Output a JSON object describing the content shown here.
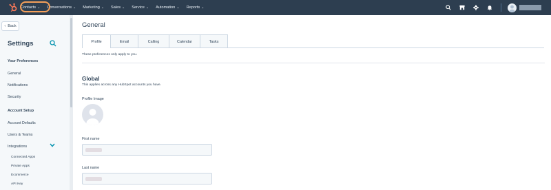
{
  "colors": {
    "topnav": "#2d3e50",
    "highlight": "#f5a05a",
    "sidebar": "#f5f8fa",
    "text": "#33475b",
    "accent": "#0091ae"
  },
  "topnav": {
    "logo_icon": "hubspot-sprocket-icon",
    "items": [
      {
        "label": "Contacts"
      },
      {
        "label": "Conversations"
      },
      {
        "label": "Marketing"
      },
      {
        "label": "Sales"
      },
      {
        "label": "Service"
      },
      {
        "label": "Automation"
      },
      {
        "label": "Reports"
      }
    ],
    "icons": [
      "search-icon",
      "marketplace-icon",
      "settings-gear-icon",
      "notifications-bell-icon"
    ]
  },
  "sidebar": {
    "back_label": "Back",
    "title": "Settings",
    "your_preferences": {
      "heading": "Your Preferences",
      "items": [
        "General",
        "Notifications",
        "Security"
      ]
    },
    "account_setup": {
      "heading": "Account Setup",
      "items": [
        "Account Defaults",
        "Users & Teams",
        "Integrations"
      ],
      "integrations_sub": [
        "Connected Apps",
        "Private Apps",
        "Ecommerce",
        "API Key"
      ]
    }
  },
  "main": {
    "title": "General",
    "tabs": [
      {
        "label": "Profile",
        "active": true
      },
      {
        "label": "Email",
        "active": false
      },
      {
        "label": "Calling",
        "active": false
      },
      {
        "label": "Calendar",
        "active": false
      },
      {
        "label": "Tasks",
        "active": false
      }
    ],
    "note": "These preferences only apply to you.",
    "section": {
      "title": "Global",
      "subtitle": "This applies across any HubSpot accounts you have.",
      "profile_image_label": "Profile Image",
      "first_name_label": "First name",
      "last_name_label": "Last name"
    }
  }
}
